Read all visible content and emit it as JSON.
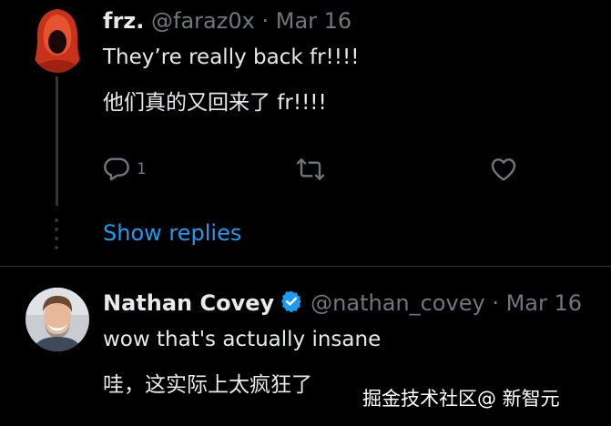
{
  "tweet1": {
    "name": "frz.",
    "handle": "@faraz0x",
    "separator": "·",
    "date": "Mar 16",
    "text_line1": "They’re really back fr!!!!",
    "text_line2": "他们真的又回来了 fr!!!!",
    "reply_count": "1",
    "reply_icon": "reply-icon",
    "retweet_icon": "retweet-icon",
    "like_icon": "heart-icon"
  },
  "show_replies": "Show replies",
  "tweet2": {
    "name": "Nathan Covey",
    "handle": "@nathan_covey",
    "separator": "·",
    "date": "Mar 16",
    "text_line1": "wow that's actually insane",
    "text_line2": "哇，这实际上太疯狂了",
    "verified_icon": "verified-badge-icon"
  },
  "watermark": "掘金技术社区@ 新智元",
  "colors": {
    "background": "#000000",
    "text": "#e7e9ea",
    "muted": "#71767b",
    "accent": "#1d9bf0",
    "divider": "#2f3336"
  }
}
